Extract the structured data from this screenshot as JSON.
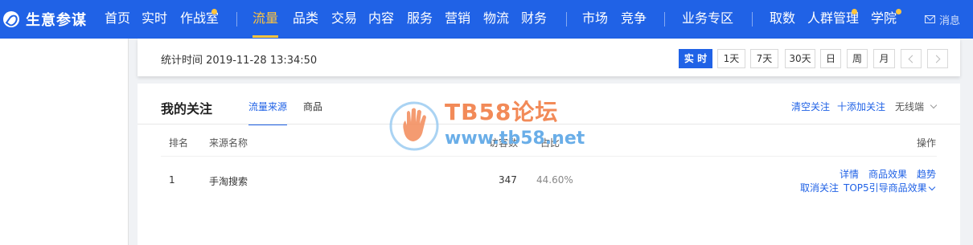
{
  "brand": {
    "name": "生意参谋"
  },
  "nav": {
    "items": [
      "首页",
      "实时",
      "作战室",
      "流量",
      "品类",
      "交易",
      "内容",
      "服务",
      "营销",
      "物流",
      "财务",
      "市场",
      "竞争",
      "业务专区",
      "取数",
      "人群管理",
      "学院"
    ],
    "active": "流量",
    "message": "消息"
  },
  "timebar": {
    "stat_label": "统计时间 2019-11-28 13:34:50",
    "buttons": [
      "实 时",
      "1天",
      "7天",
      "30天",
      "日",
      "周",
      "月"
    ],
    "active": "实 时"
  },
  "panel": {
    "title": "我的关注",
    "tabs": [
      "流量来源",
      "商品"
    ],
    "active_tab": "流量来源",
    "actions": {
      "clear": "清空关注",
      "add": "十添加关注",
      "device": "无线端"
    },
    "columns": {
      "rank": "排名",
      "source": "来源名称",
      "visitors": "访客数",
      "share": "占比",
      "ops": "操作"
    },
    "rows": [
      {
        "rank": "1",
        "source": "手淘搜索",
        "visitors": "347",
        "share": "44.60%",
        "links": {
          "detail": "详情",
          "product_effect": "商品效果",
          "trend": "趋势",
          "unfollow": "取消关注",
          "top5": "TOP5引导商品效果"
        }
      }
    ]
  },
  "watermark": {
    "title": "TB58论坛",
    "url": "www.tb58.net"
  },
  "colors": {
    "nav_bg": "#2062e6",
    "accent": "#ffc53d",
    "link": "#2062e6"
  }
}
